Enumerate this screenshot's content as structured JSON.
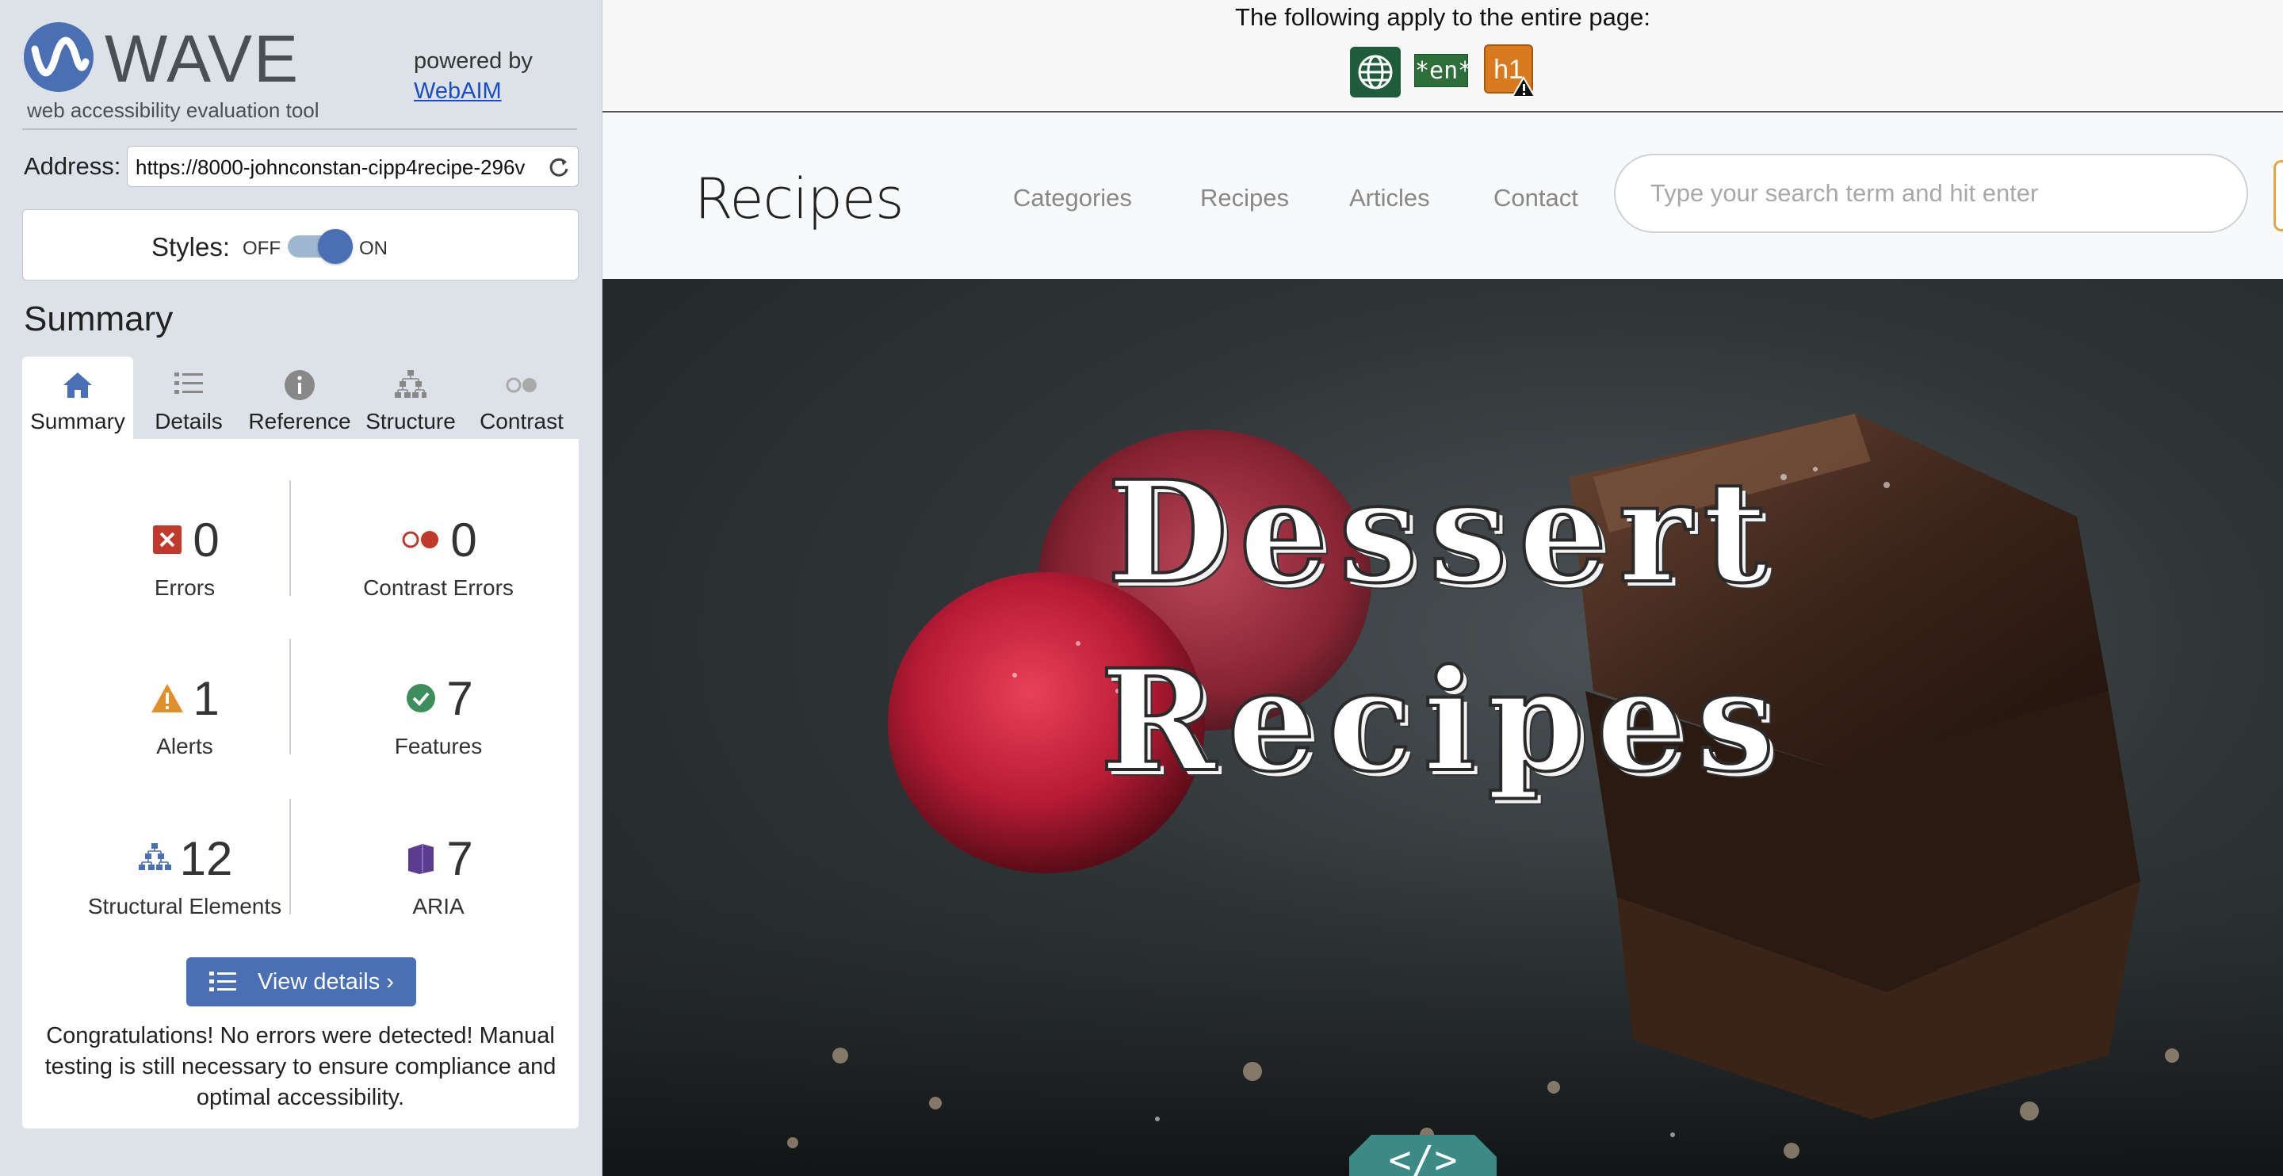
{
  "wave": {
    "title": "WAVE",
    "tagline": "web accessibility evaluation tool",
    "powered_by": "powered by",
    "powered_link": "WebAIM",
    "address_label": "Address:",
    "address_value": "https://8000-johnconstan-cipp4recipe-296v",
    "styles_label": "Styles:",
    "styles_off": "OFF",
    "styles_on": "ON",
    "styles_enabled": true,
    "summary_heading": "Summary",
    "tabs": [
      {
        "label": "Summary",
        "icon": "home-icon",
        "active": true
      },
      {
        "label": "Details",
        "icon": "list-icon",
        "active": false
      },
      {
        "label": "Reference",
        "icon": "info-icon",
        "active": false
      },
      {
        "label": "Structure",
        "icon": "structure-icon",
        "active": false
      },
      {
        "label": "Contrast",
        "icon": "contrast-icon",
        "active": false
      }
    ],
    "stats": {
      "errors": {
        "count": "0",
        "label": "Errors"
      },
      "contrast_errors": {
        "count": "0",
        "label": "Contrast Errors"
      },
      "alerts": {
        "count": "1",
        "label": "Alerts"
      },
      "features": {
        "count": "7",
        "label": "Features"
      },
      "structural": {
        "count": "12",
        "label": "Structural Elements"
      },
      "aria": {
        "count": "7",
        "label": "ARIA"
      }
    },
    "view_details_label": "View details ›",
    "congrats": "Congratulations! No errors were detected! Manual testing is still necessary to ensure compliance and optimal accessibility."
  },
  "page": {
    "notice": "The following apply to the entire page:",
    "notice_icons": [
      {
        "name": "language-globe-icon",
        "text": ""
      },
      {
        "name": "lang-en-icon",
        "text": "*en*"
      },
      {
        "name": "h1-alert-icon",
        "text": "h1"
      }
    ],
    "site_logo": "Recipes",
    "nav": [
      "Categories",
      "Recipes",
      "Articles",
      "Contact"
    ],
    "search_placeholder": "Type your search term and hit enter",
    "hero_line1": "Dessert",
    "hero_line2": "Recipes",
    "code_badge": "</>"
  },
  "colors": {
    "wave_blue": "#4a6fb5",
    "error_red": "#c0392b",
    "alert_orange": "#e0902a",
    "feature_green": "#3c8f5b",
    "aria_purple": "#5b3c8f",
    "badge_teal": "#3b8a86"
  }
}
